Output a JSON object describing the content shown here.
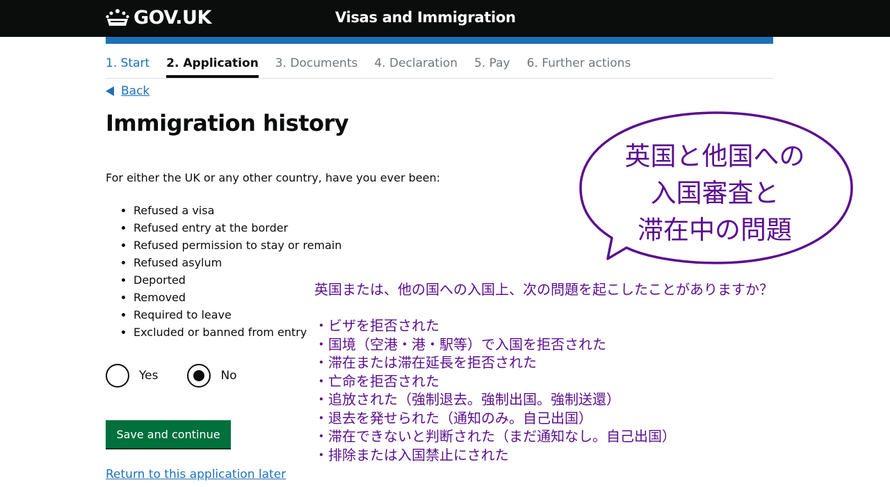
{
  "header": {
    "logo_text": "GOV.UK",
    "logo_icon": "crown-icon",
    "service_name": "Visas and Immigration"
  },
  "steps": [
    {
      "label": "1. Start",
      "state": "done"
    },
    {
      "label": "2. Application",
      "state": "current"
    },
    {
      "label": "3. Documents",
      "state": "upcoming"
    },
    {
      "label": "4. Declaration",
      "state": "upcoming"
    },
    {
      "label": "5. Pay",
      "state": "upcoming"
    },
    {
      "label": "6. Further actions",
      "state": "upcoming"
    }
  ],
  "back_link": "Back",
  "page_title": "Immigration history",
  "intro": "For either the UK or any other country, have you ever been:",
  "reasons": [
    "Refused a visa",
    "Refused entry at the border",
    "Refused permission to stay or remain",
    "Refused asylum",
    "Deported",
    "Removed",
    "Required to leave",
    "Excluded or banned from entry"
  ],
  "options": [
    {
      "label": "Yes",
      "checked": false
    },
    {
      "label": "No",
      "checked": true
    }
  ],
  "save_button": "Save and continue",
  "return_link": "Return to this application later",
  "annotation": {
    "bubble_lines": [
      "英国と他国への",
      "入国審査と",
      "滞在中の問題"
    ],
    "question": "英国または、他の国への入国上、次の問題を起こしたことがありますか？",
    "items": [
      "・ビザを拒否された",
      "・国境（空港・港・駅等）で入国を拒否された",
      "・滞在または滞在延長を拒否された",
      "・亡命を拒否された",
      "・追放された（強制退去。強制出国。強制送還）",
      "・退去を発せられた（通知のみ。自己出国）",
      "・滞在できないと判断された（まだ通知なし。自己出国）",
      "・排除または入国禁止にされた"
    ],
    "color": "#5b0f8e"
  },
  "colors": {
    "header_bg": "#0b0c0c",
    "accent_blue": "#1d70b8",
    "button_green": "#00703c"
  }
}
